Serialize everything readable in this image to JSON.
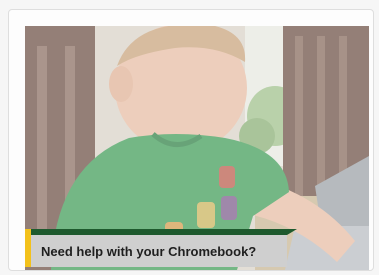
{
  "card": {
    "image_alt": "child-using-chromebook",
    "banner_text": "Need help with your Chromebook?"
  },
  "colors": {
    "banner_bg": "#cfcfcf",
    "banner_stripe": "#1e5a2e",
    "banner_accent": "#f3c11b"
  }
}
